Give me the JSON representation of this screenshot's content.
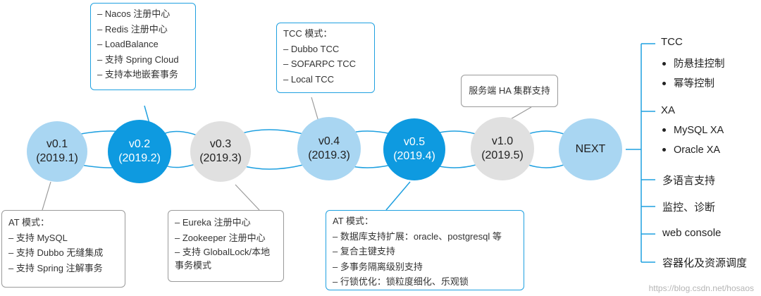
{
  "nodes": [
    {
      "version": "v0.1",
      "date": "(2019.1)"
    },
    {
      "version": "v0.2",
      "date": "(2019.2)"
    },
    {
      "version": "v0.3",
      "date": "(2019.3)"
    },
    {
      "version": "v0.4",
      "date": "(2019.3)"
    },
    {
      "version": "v0.5",
      "date": "(2019.4)"
    },
    {
      "version": "v1.0",
      "date": "(2019.5)"
    },
    {
      "label": "NEXT"
    }
  ],
  "callouts": {
    "v01": [
      "AT 模式：",
      "– 支持 MySQL",
      "– 支持 Dubbo 无缝集成",
      "– 支持 Spring 注解事务"
    ],
    "v02": [
      "– Nacos 注册中心",
      "– Redis 注册中心",
      "– LoadBalance",
      "– 支持 Spring Cloud",
      "– 支持本地嵌套事务"
    ],
    "v03": [
      "– Eureka 注册中心",
      "– Zookeeper 注册中心",
      "– 支持 GlobalLock/本地事务模式"
    ],
    "v04": [
      "TCC 模式：",
      "– Dubbo TCC",
      "– SOFARPC TCC",
      "– Local TCC"
    ],
    "v05": [
      "AT 模式：",
      "– 数据库支持扩展：oracle、postgresql 等",
      "– 复合主键支持",
      "– 多事务隔离级别支持",
      "– 行锁优化：锁粒度细化、乐观锁"
    ],
    "v10": [
      "服务端 HA 集群支持"
    ]
  },
  "next": {
    "tcc": "TCC",
    "tcc_items": [
      "防悬挂控制",
      "幂等控制"
    ],
    "xa": "XA",
    "xa_items": [
      "MySQL XA",
      "Oracle XA"
    ],
    "multi_lang": "多语言支持",
    "monitor": "监控、诊断",
    "web_console": "web console",
    "container": "容器化及资源调度"
  },
  "watermark": "https://blog.csdn.net/hosaos",
  "colors": {
    "light_blue": "#a9d6f2",
    "dark_blue": "#0e9ae0",
    "gray": "#e0e0e0",
    "line_blue": "#1fa0e0",
    "callout_gray_border": "#9a9a9a"
  }
}
